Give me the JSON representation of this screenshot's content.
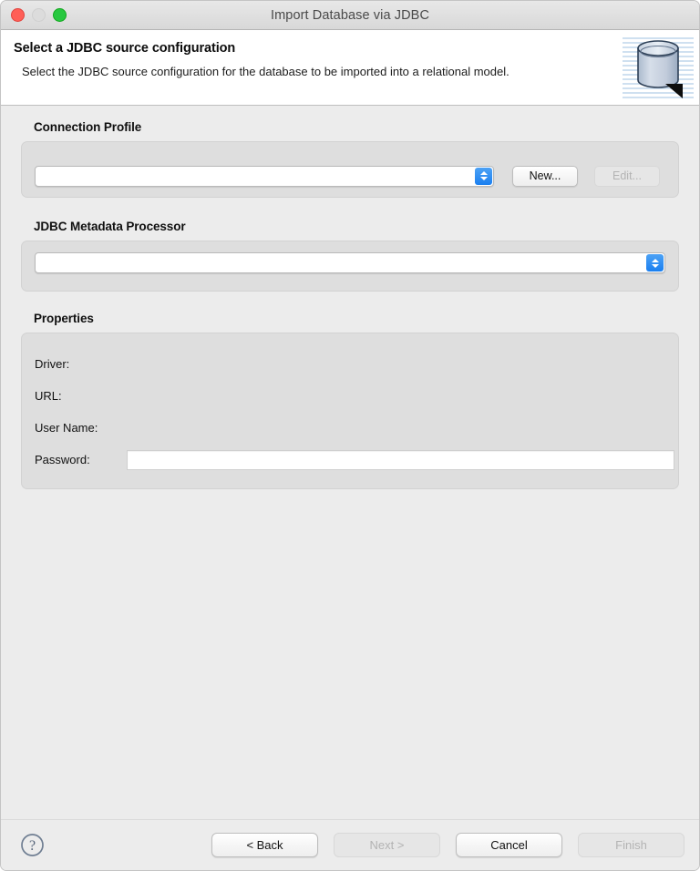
{
  "window": {
    "title": "Import Database via JDBC",
    "traffic_lights": [
      {
        "name": "close",
        "enabled": true
      },
      {
        "name": "minimize",
        "enabled": false
      },
      {
        "name": "zoom",
        "enabled": true
      }
    ]
  },
  "header": {
    "title": "Select a JDBC source configuration",
    "description": "Select the JDBC source configuration for the database to be imported into a relational model.",
    "icon": "database-icon"
  },
  "sections": {
    "connection_profile": {
      "label": "Connection Profile",
      "combo": {
        "value": "",
        "placeholder": ""
      },
      "new_button": {
        "label": "New...",
        "enabled": true
      },
      "edit_button": {
        "label": "Edit...",
        "enabled": false
      }
    },
    "metadata_processor": {
      "label": "JDBC Metadata Processor",
      "combo": {
        "value": "",
        "placeholder": ""
      }
    },
    "properties": {
      "label": "Properties",
      "rows": [
        {
          "label": "Driver:",
          "value": ""
        },
        {
          "label": "URL:",
          "value": ""
        },
        {
          "label": "User Name:",
          "value": ""
        }
      ],
      "password": {
        "label": "Password:",
        "value": "",
        "placeholder": ""
      }
    }
  },
  "footer": {
    "help": {
      "icon": "help-question-icon"
    },
    "buttons": [
      {
        "label": "< Back",
        "enabled": true
      },
      {
        "label": "Next >",
        "enabled": false
      },
      {
        "label": "Cancel",
        "enabled": true
      },
      {
        "label": "Finish",
        "enabled": false
      }
    ]
  },
  "colors": {
    "accent_blue": "#1a7ff0",
    "window_bg": "#ececec",
    "group_bg": "#dedede",
    "header_bg": "#ffffff",
    "close_red": "#ff5f57",
    "zoom_green": "#28c840",
    "min_grey": "#dcdcdc"
  }
}
